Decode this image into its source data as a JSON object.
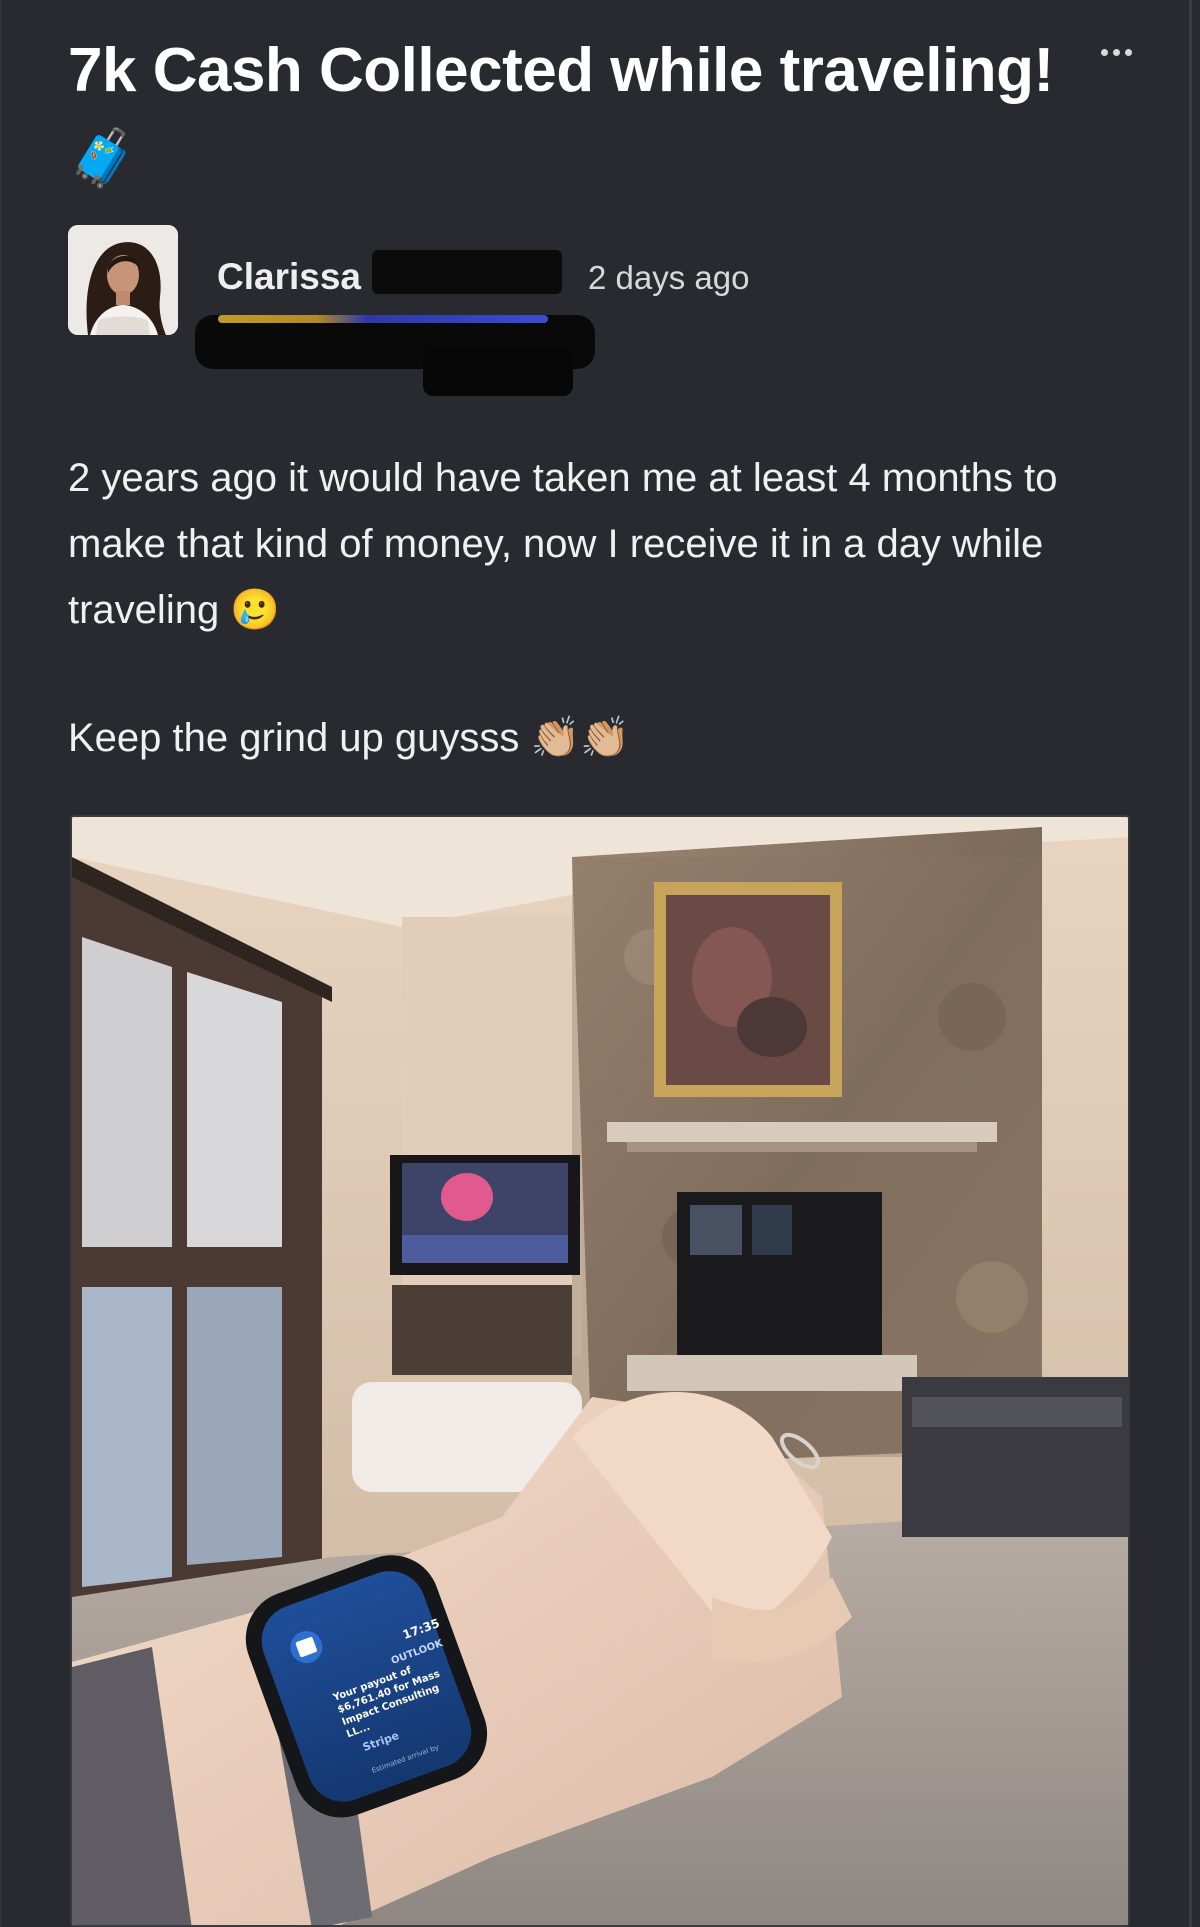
{
  "post": {
    "title": "7k Cash Collected while traveling!",
    "title_emoji": "🧳",
    "more_icon": "more-horizontal-icon",
    "author": {
      "name": "Clarissa",
      "timestamp": "2 days ago"
    },
    "body": {
      "paragraph_1": "2 years ago it would have taken me at least 4 months to make that kind of money, now I receive it in a day while traveling",
      "paragraph_1_emoji": "🥲",
      "paragraph_2": "Keep the grind up guysss",
      "paragraph_2_emoji": "👏🏼👏🏼"
    },
    "photo": {
      "watch": {
        "time": "17:35",
        "app": "OUTLOOK",
        "message": "Your payout of $6,761.40 for Mass Impact Consulting LL...",
        "sender": "Stripe",
        "footer": "Estimated arrival by"
      }
    }
  },
  "colors": {
    "background": "#292a2f",
    "text": "#f0f0f2",
    "muted": "#d8d8db"
  }
}
